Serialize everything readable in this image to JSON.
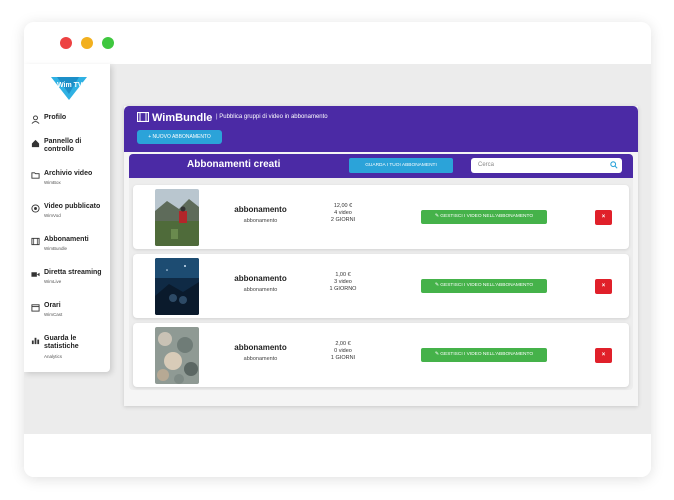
{
  "sidebar": {
    "logo_text": "Wim TV",
    "items": [
      {
        "icon": "user-icon",
        "label": "Profilo",
        "sub": ""
      },
      {
        "icon": "dashboard-icon",
        "label": "Pannello di controllo",
        "sub": ""
      },
      {
        "icon": "folder-icon",
        "label": "Archivio video",
        "sub": "WimBox"
      },
      {
        "icon": "broadcast-icon",
        "label": "Video pubblicato",
        "sub": "WimVod"
      },
      {
        "icon": "film-icon",
        "label": "Abbonamenti",
        "sub": "WimBundle"
      },
      {
        "icon": "camera-icon",
        "label": "Diretta streaming",
        "sub": "WimLive"
      },
      {
        "icon": "calendar-icon",
        "label": "Orari",
        "sub": "WimCast"
      },
      {
        "icon": "bar-chart-icon",
        "label": "Guarda le statistiche",
        "sub": "Analytics"
      }
    ]
  },
  "main": {
    "title": "WimBundle",
    "subtitle": "| Pubblica gruppi di video in abbonamento",
    "new_button": "+ NUOVO ABBONAMENTO",
    "section_title": "Abbonamenti creati",
    "view_all_button": "GUARDA I TUOI ABBONAMENTI",
    "search_placeholder": "Cerca"
  },
  "cards": [
    {
      "name": "abbonamento",
      "desc": "abbonamento",
      "price": "12,00 €",
      "videos": "4 video",
      "duration": "2 GIORNI",
      "manage": "GESTISCI I VIDEO NELL'ABBONAMENTO",
      "delete": "×"
    },
    {
      "name": "abbonamento",
      "desc": "abbonamento",
      "price": "1,00 €",
      "videos": "3 video",
      "duration": "1 GIORNO",
      "manage": "GESTISCI I VIDEO NELL'ABBONAMENTO",
      "delete": "×"
    },
    {
      "name": "abbonamento",
      "desc": "abbonamento",
      "price": "2,00 €",
      "videos": "0 video",
      "duration": "1 GIORNI",
      "manage": "GESTISCI I VIDEO NELL'ABBONAMENTO",
      "delete": "×"
    }
  ],
  "colors": {
    "header": "#4b2aa5",
    "accent_blue": "#2ba3d9",
    "manage_green": "#45b24a",
    "delete_red": "#e0202a"
  }
}
